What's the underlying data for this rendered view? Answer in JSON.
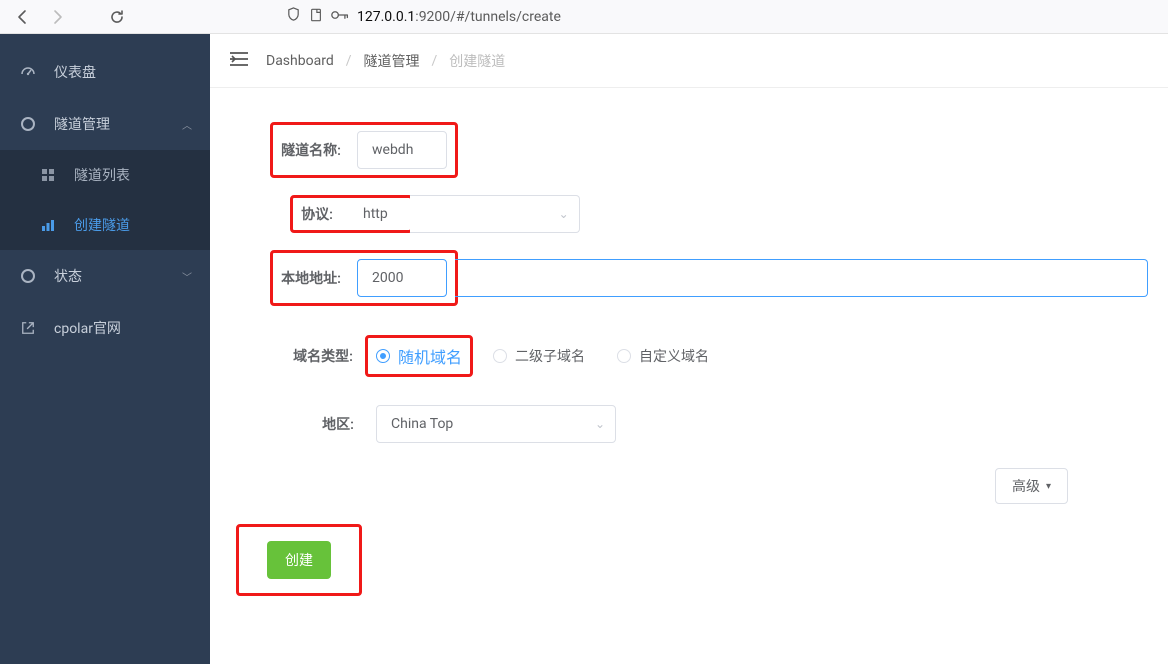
{
  "browser": {
    "url_host": "127.0.0.1",
    "url_rest": ":9200/#/tunnels/create"
  },
  "sidebar": {
    "items": [
      {
        "label": "仪表盘"
      },
      {
        "label": "隧道管理"
      },
      {
        "label": "隧道列表"
      },
      {
        "label": "创建隧道"
      },
      {
        "label": "状态"
      },
      {
        "label": "cpolar官网"
      }
    ]
  },
  "breadcrumb": {
    "a": "Dashboard",
    "b": "隧道管理",
    "c": "创建隧道"
  },
  "form": {
    "tunnel_name_label": "隧道名称:",
    "tunnel_name_value": "webdh",
    "protocol_label": "协议:",
    "protocol_value": "http",
    "local_addr_label": "本地地址:",
    "local_addr_value": "2000",
    "domain_type_label": "域名类型:",
    "domain_type_options": {
      "random": "随机域名",
      "sub": "二级子域名",
      "custom": "自定义域名"
    },
    "region_label": "地区:",
    "region_value": "China Top",
    "advanced_label": "高级",
    "create_label": "创建"
  }
}
